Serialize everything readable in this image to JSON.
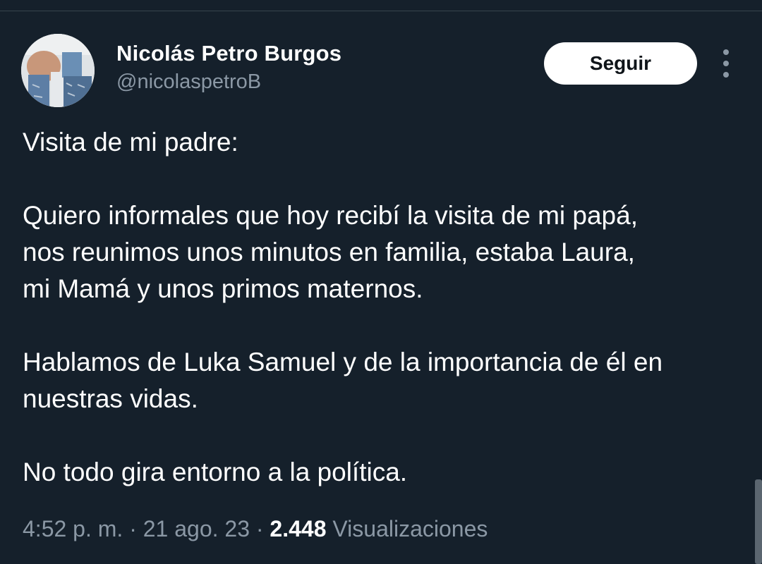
{
  "author": {
    "display_name": "Nicolás Petro Burgos",
    "handle": "@nicolaspetroB"
  },
  "actions": {
    "follow_label": "Seguir",
    "more_icon": "more-vertical-icon"
  },
  "tweet": {
    "paragraph_1": "Visita de mi padre:",
    "paragraph_2_line_1": "Quiero informales que hoy recibí la visita de mi papá,",
    "paragraph_2_line_2": "nos reunimos unos minutos en familia, estaba Laura,",
    "paragraph_2_line_3": "mi Mamá y unos primos maternos.",
    "paragraph_3_line_1": "Hablamos de Luka Samuel y de la importancia de él en",
    "paragraph_3_line_2": "nuestras vidas.",
    "paragraph_4": "No todo gira entorno a la política."
  },
  "meta": {
    "time": "4:52 p. m.",
    "separator": " · ",
    "date": "21 ago. 23",
    "views_count": "2.448",
    "views_label": "Visualizaciones"
  },
  "colors": {
    "background": "#15202b",
    "primary_text": "#ffffff",
    "secondary_text": "#8b98a5",
    "follow_button_bg": "#ffffff",
    "follow_button_text": "#0f1419"
  }
}
